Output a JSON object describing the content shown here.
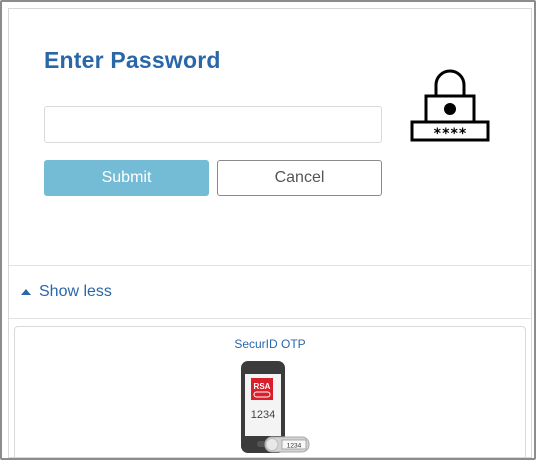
{
  "form": {
    "title": "Enter Password",
    "password_value": "",
    "password_placeholder": "",
    "submit_label": "Submit",
    "cancel_label": "Cancel"
  },
  "toggle": {
    "label": "Show less"
  },
  "methods": [
    {
      "label": "SecurID OTP",
      "icon": "rsa-phone-token-icon",
      "phone_code": "1234",
      "token_code": "1234",
      "brand_text": "RSA"
    }
  ],
  "icons": {
    "lock": "padlock-password-icon",
    "toggle": "caret-up-icon"
  },
  "colors": {
    "title": "#2a67a8",
    "submit_bg": "#74bcd5",
    "link": "#2a67a8",
    "rsa_red": "#d81f2a"
  }
}
